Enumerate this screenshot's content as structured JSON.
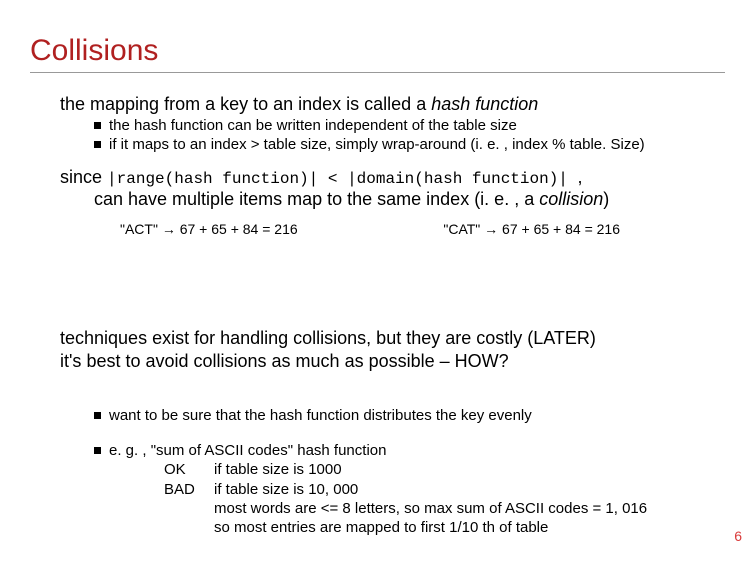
{
  "title": "Collisions",
  "p1": {
    "lead": "the mapping from a key to an index is called a ",
    "hash_function": "hash function",
    "b1": "the hash function can be written independent of the table size",
    "b2": "if it maps to an index > table size, simply wrap-around (i. e. , index % table. Size)"
  },
  "p2": {
    "since": "since ",
    "code": "|range(hash function)| < |domain(hash function)| ",
    "comma": ",",
    "collision_line1": "can have multiple items map to the same index (i. e. , a ",
    "collision_word": "collision",
    "collision_line2": ")",
    "exA": "\"ACT\" → 67 + 65 + 84 = 216",
    "exB": "\"CAT\" → 67 + 65 + 84 = 216"
  },
  "p3": {
    "line1": "techniques exist for handling collisions, but they are costly (LATER)",
    "line2": "it's best to avoid collisions as much as possible – HOW?",
    "b1": "want to be sure that the hash function distributes the key evenly"
  },
  "p4": {
    "b1": "e. g. , \"sum of ASCII codes\" hash function",
    "ok_label": "OK",
    "ok_text": "if table size is 1000",
    "bad_label": "BAD",
    "bad_text": "if table size is 10, 000",
    "bad2": "most words are <= 8 letters, so max sum of ASCII codes = 1, 016",
    "bad3": "so most entries are mapped to first 1/10 th of table"
  },
  "page_number": "6"
}
